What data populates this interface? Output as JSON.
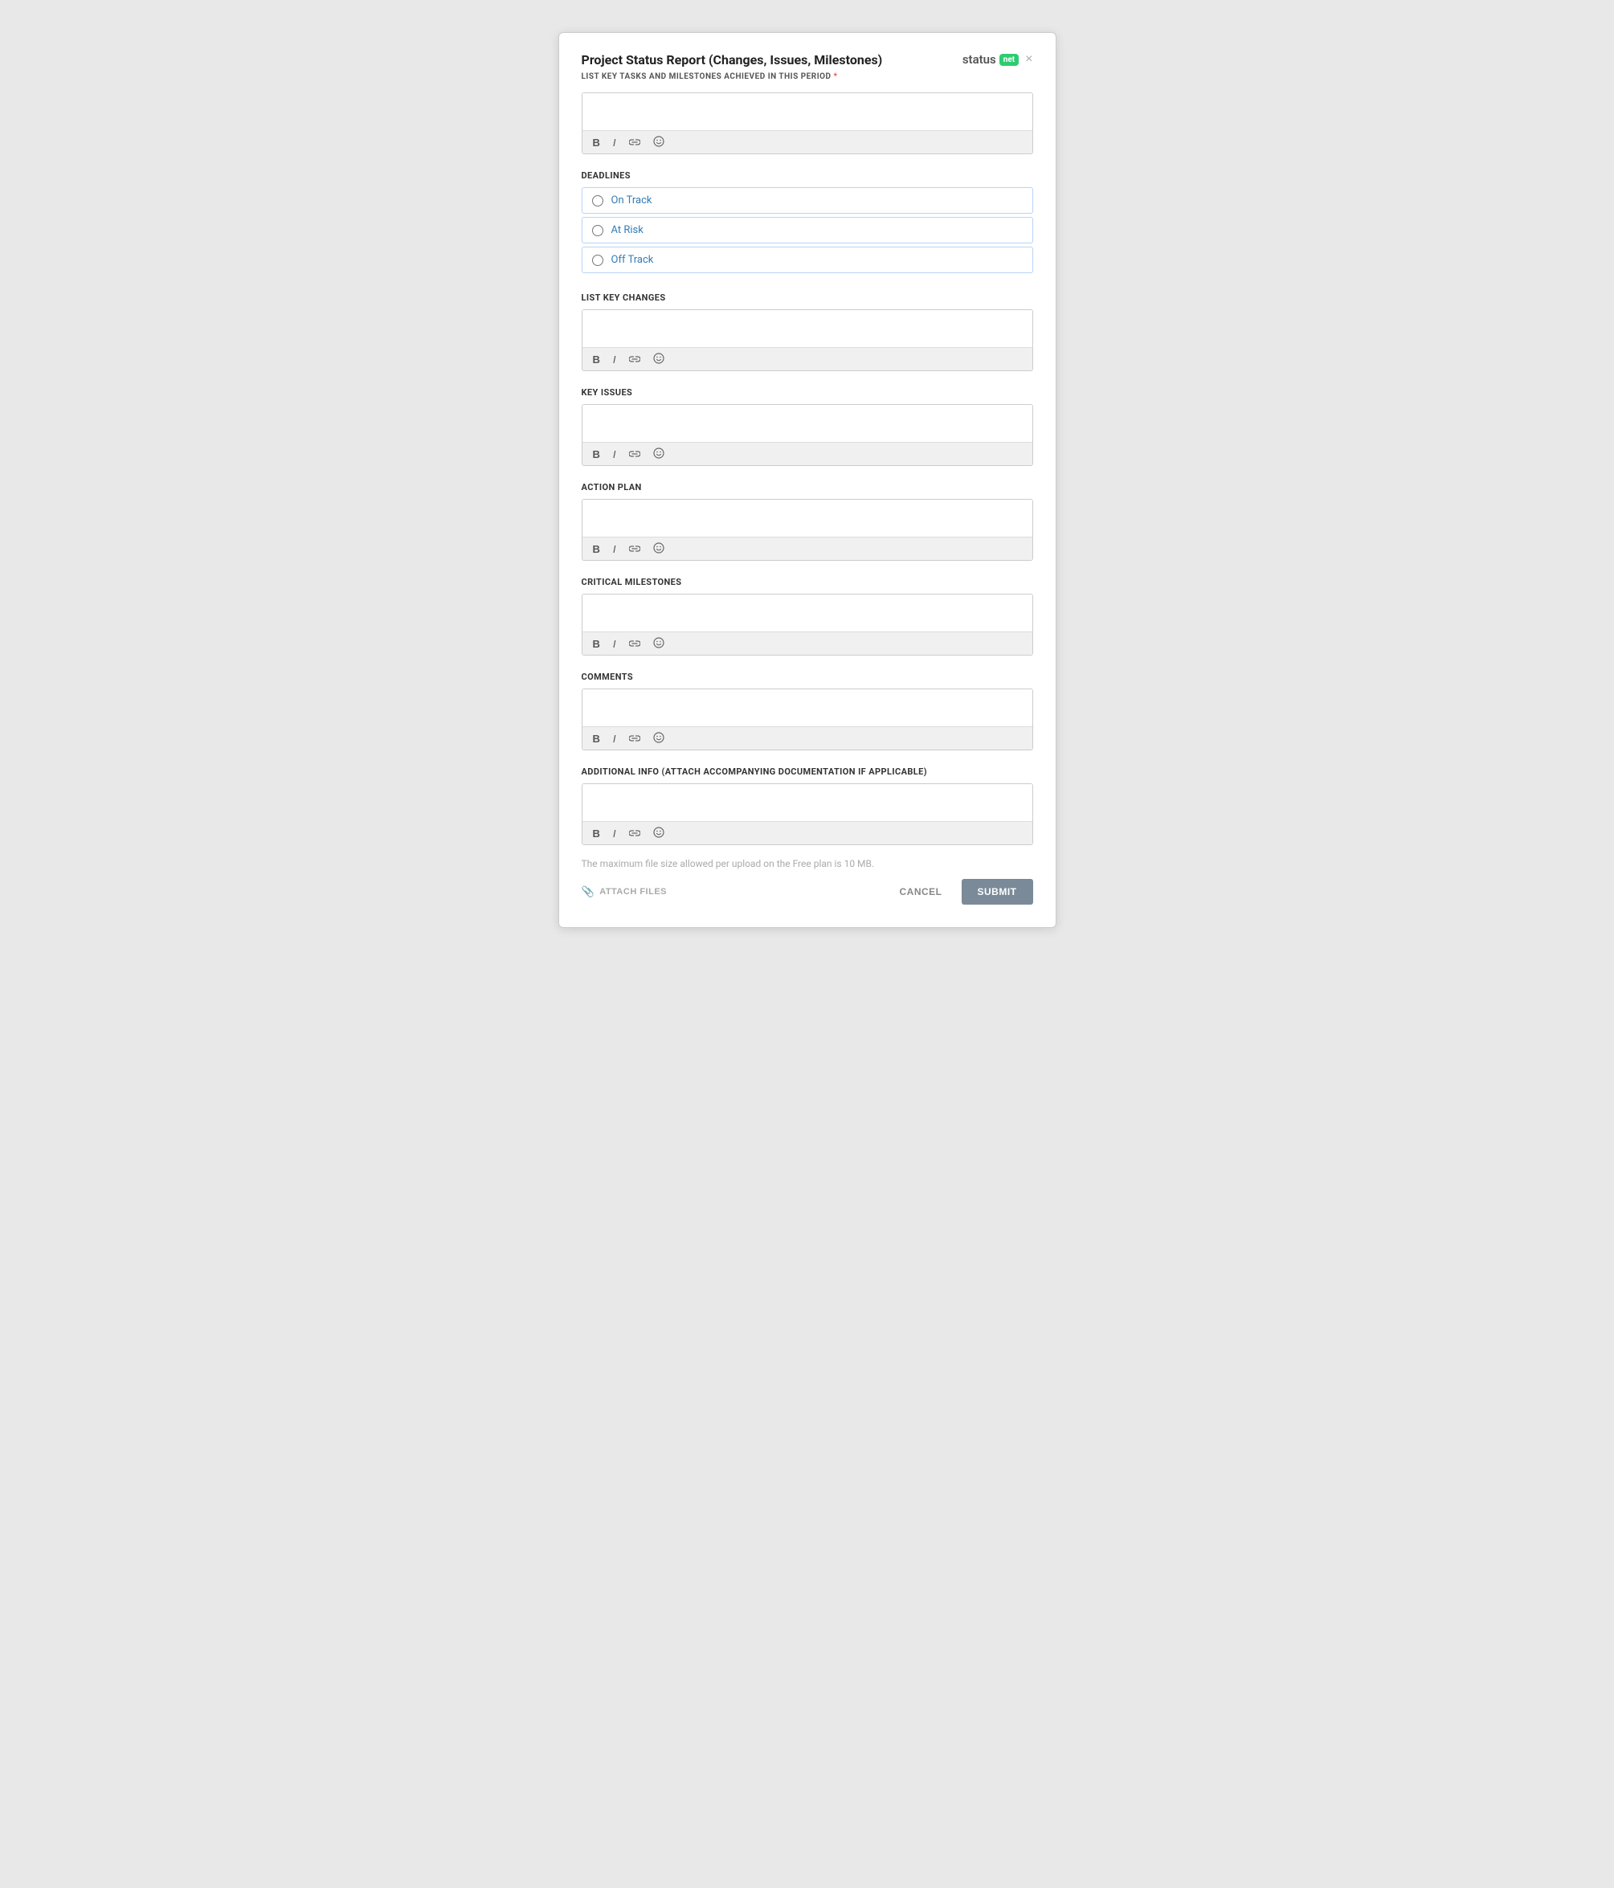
{
  "modal": {
    "title": "Project Status Report (Changes, Issues, Milestones)",
    "subtitle": "LIST KEY TASKS AND MILESTONES ACHIEVED IN THIS PERIOD",
    "required_indicator": "*",
    "close_icon": "×"
  },
  "status_logo": {
    "text": "status",
    "badge": "net"
  },
  "deadlines": {
    "label": "DEADLINES",
    "options": [
      {
        "value": "on_track",
        "label": "On Track"
      },
      {
        "value": "at_risk",
        "label": "At Risk"
      },
      {
        "value": "off_track",
        "label": "Off Track"
      }
    ]
  },
  "sections": [
    {
      "id": "key_tasks",
      "label": null
    },
    {
      "id": "list_key_changes",
      "label": "LIST KEY CHANGES"
    },
    {
      "id": "key_issues",
      "label": "KEY ISSUES"
    },
    {
      "id": "action_plan",
      "label": "ACTION PLAN"
    },
    {
      "id": "critical_milestones",
      "label": "CRITICAL MILESTONES"
    },
    {
      "id": "comments",
      "label": "COMMENTS"
    },
    {
      "id": "additional_info",
      "label": "ADDITIONAL INFO (ATTACH ACCOMPANYING DOCUMENTATION IF APPLICABLE)"
    }
  ],
  "toolbar": {
    "bold": "B",
    "italic": "I",
    "link": "link",
    "emoji": "emoji"
  },
  "footer": {
    "file_size_note": "The maximum file size allowed per upload on the Free plan is 10 MB.",
    "attach_label": "ATTACH FILES",
    "cancel_label": "CANCEL",
    "submit_label": "SUBMIT"
  }
}
